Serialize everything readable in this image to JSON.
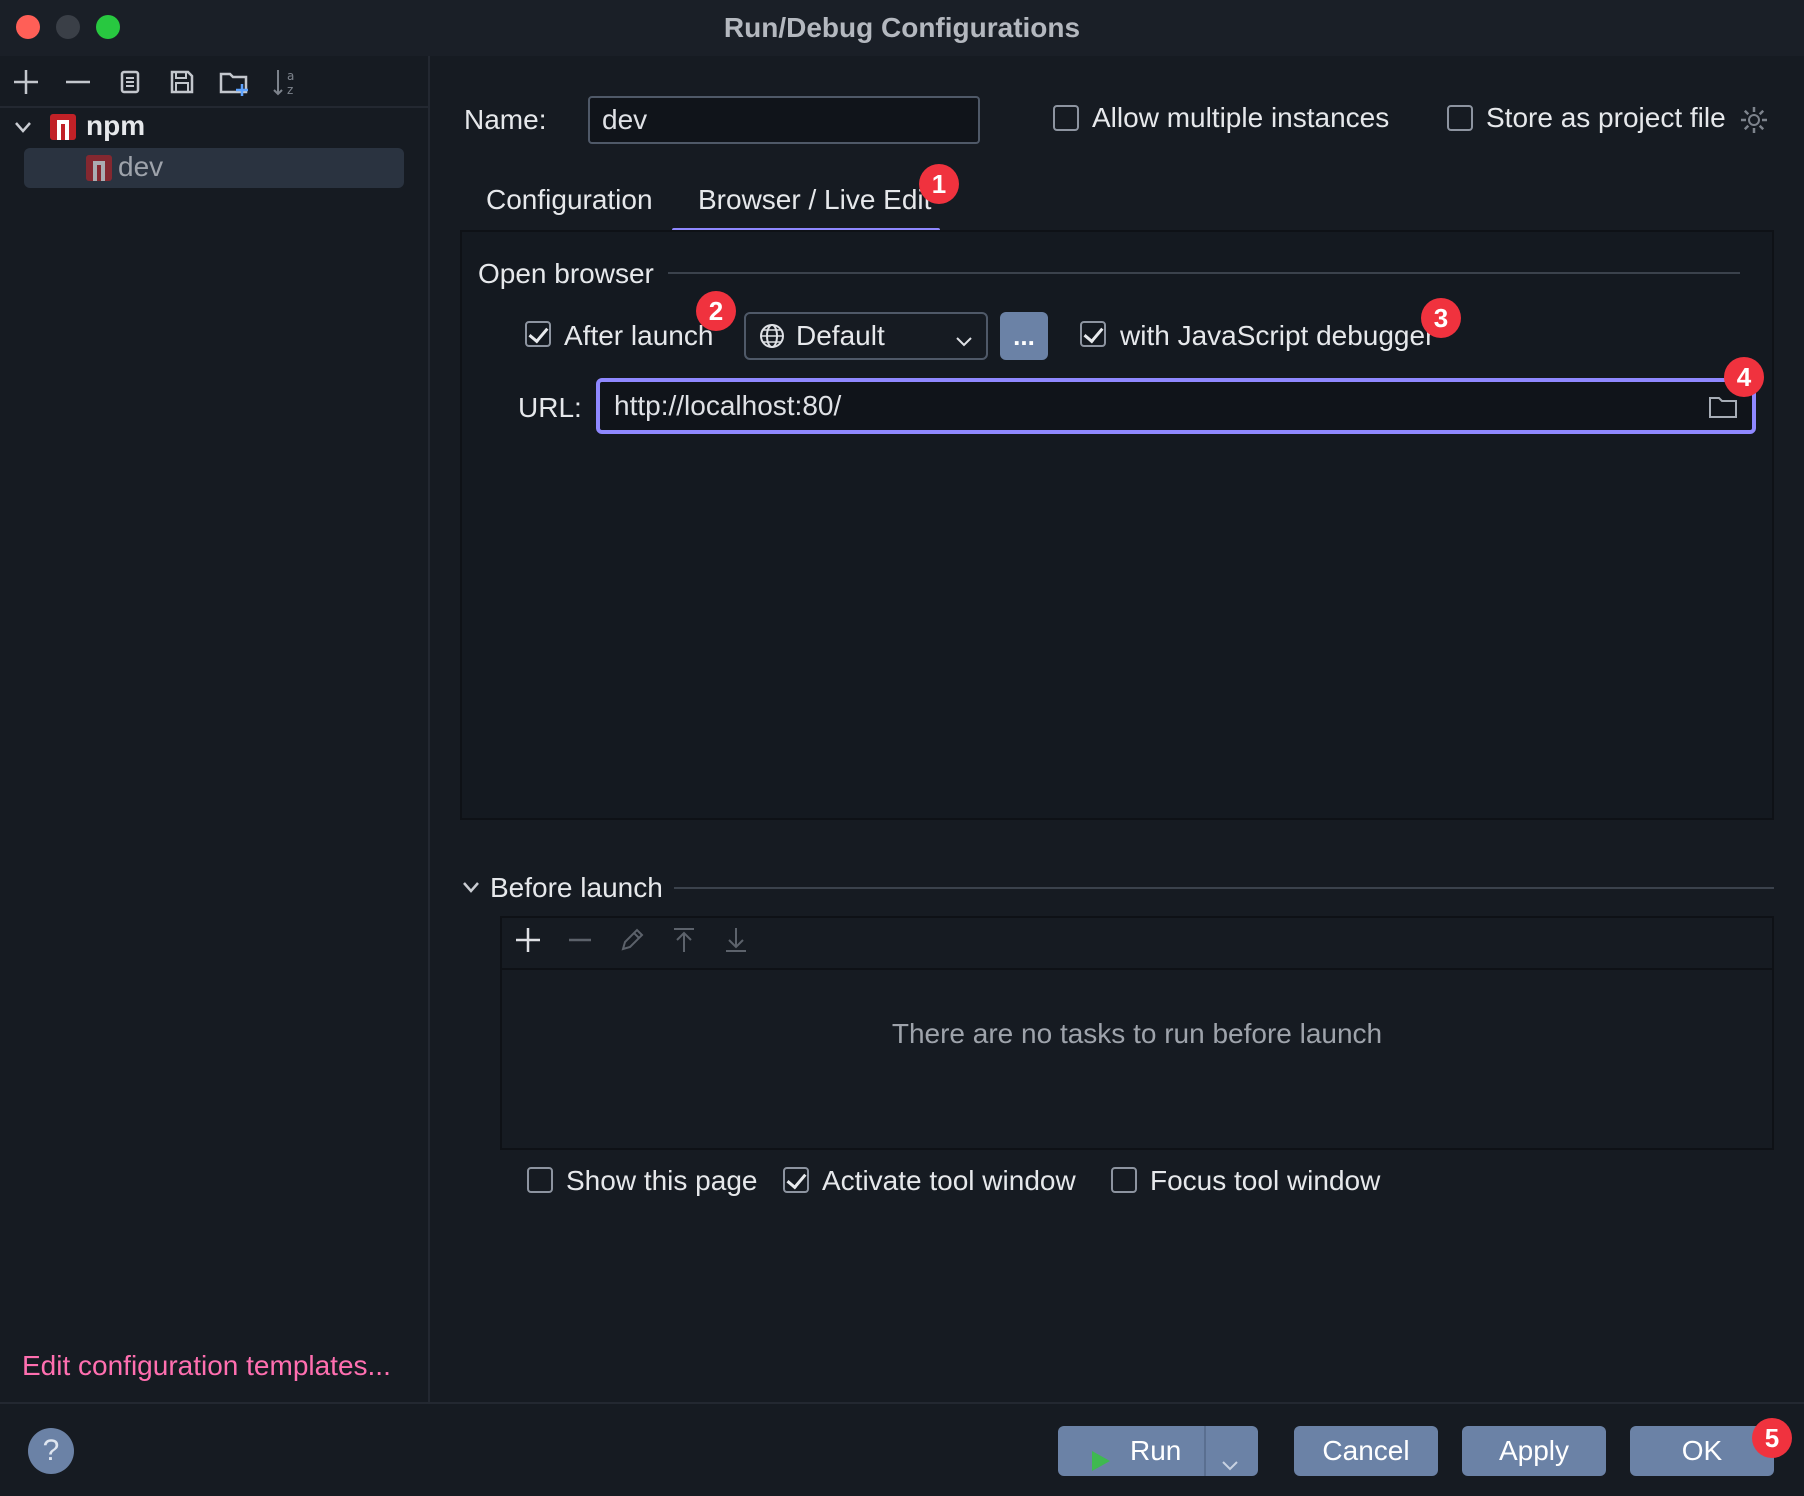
{
  "window": {
    "title": "Run/Debug Configurations"
  },
  "sidebar": {
    "tree": {
      "group_label": "npm",
      "item_label": "dev"
    },
    "edit_templates_link": "Edit configuration templates..."
  },
  "header": {
    "name_label": "Name:",
    "name_value": "dev",
    "allow_multiple_label": "Allow multiple instances",
    "store_project_label": "Store as project file"
  },
  "tabs": [
    {
      "label": "Configuration",
      "selected": false
    },
    {
      "label": "Browser / Live Edit",
      "selected": true
    }
  ],
  "open_browser": {
    "section_title": "Open browser",
    "after_launch_label": "After launch",
    "browser_select": "Default",
    "more_button": "...",
    "js_debugger_label": "with JavaScript debugger",
    "url_label": "URL:",
    "url_value": "http://localhost:80/"
  },
  "before_launch": {
    "section_title": "Before launch",
    "empty_message": "There are no tasks to run before launch",
    "show_page_label": "Show this page",
    "activate_tool_label": "Activate tool window",
    "focus_tool_label": "Focus tool window"
  },
  "footer": {
    "help": "?",
    "run_label": "Run",
    "cancel_label": "Cancel",
    "apply_label": "Apply",
    "ok_label": "OK"
  },
  "annotations": [
    "1",
    "2",
    "3",
    "4",
    "5"
  ],
  "colors": {
    "accent": "#8f88ff",
    "badge": "#f0323e",
    "link": "#ff6fb0",
    "button": "#6b82a6"
  }
}
